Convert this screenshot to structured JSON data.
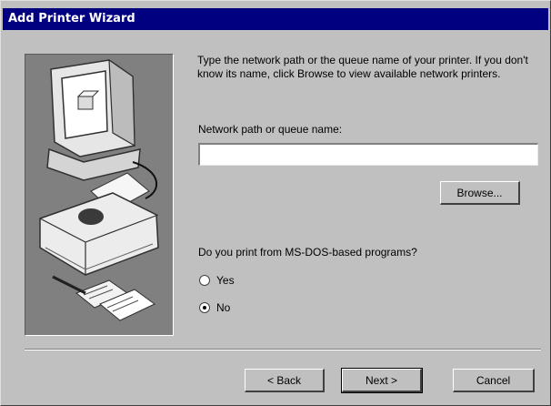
{
  "window": {
    "title": "Add Printer Wizard"
  },
  "content": {
    "instructions": "Type the network path or the queue name of your printer. If you don't know its name, click Browse to view available network printers.",
    "network_path_label": "Network path or queue name:",
    "network_path_value": "",
    "browse_label": "Browse...",
    "msdos_question": "Do you print from MS-DOS-based programs?",
    "options": [
      {
        "label": "Yes",
        "selected": false
      },
      {
        "label": "No",
        "selected": true
      }
    ]
  },
  "buttons": {
    "back_label": "< Back",
    "next_label": "Next >",
    "cancel_label": "Cancel"
  },
  "icons": [
    "computer-printer-illustration"
  ]
}
